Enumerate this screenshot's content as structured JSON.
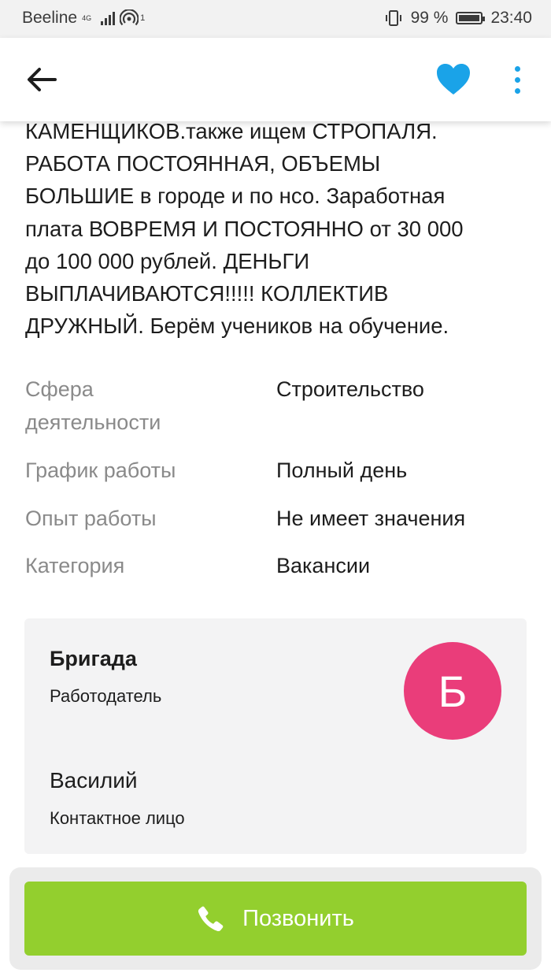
{
  "status": {
    "carrier": "Beeline",
    "network": "4G",
    "hotspot_badge": "1",
    "battery": "99 %",
    "time": "23:40"
  },
  "toolbar": {
    "back_icon": "arrow-left-icon",
    "favorite_icon": "heart-icon",
    "more_icon": "dots-vertical-icon",
    "accent": "#1aa3e8"
  },
  "description": {
    "lines": [
      "КАМЕНЩИКОВ.также ищем СТРОПАЛЯ.",
      "РАБОТА ПОСТОЯННАЯ, ОБЪЕМЫ",
      "БОЛЬШИЕ  в городе и по нсо. Заработная",
      "плата ВОВРЕМЯ И ПОСТОЯННО от 30 000",
      "до  100 000 рублей. ДЕНЬГИ",
      "ВЫПЛАЧИВАЮТСЯ!!!!! КОЛЛЕКТИВ",
      "ДРУЖНЫЙ. Берём учеников на обучение."
    ]
  },
  "attributes": [
    {
      "label_line1": "Сфера",
      "label_line2": "деятельности",
      "value": "Строительство"
    },
    {
      "label": "График работы",
      "value": "Полный день"
    },
    {
      "label": "Опыт работы",
      "value": "Не имеет значения"
    },
    {
      "label": "Категория",
      "value": "Вакансии"
    }
  ],
  "employer": {
    "name": "Бригада",
    "role": "Работодатель",
    "avatar_letter": "Б",
    "avatar_color": "#ea3d7a",
    "contact_name": "Василий",
    "contact_role": "Контактное лицо"
  },
  "call": {
    "label": "Позвонить",
    "icon": "phone-icon",
    "color": "#93cf2e"
  }
}
